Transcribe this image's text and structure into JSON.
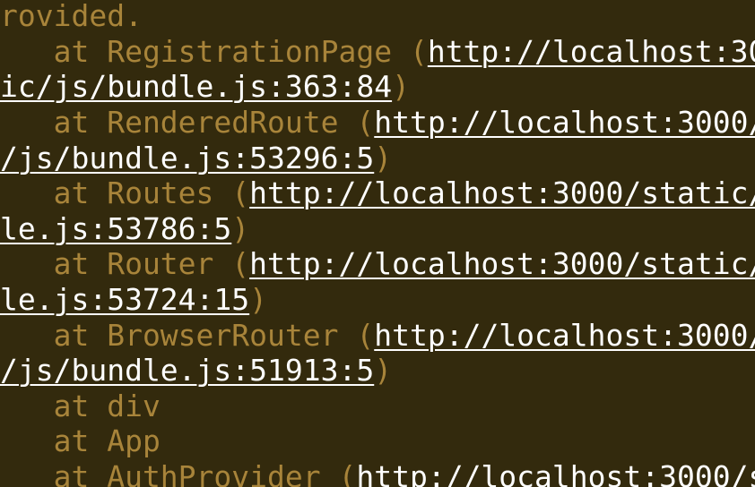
{
  "error_log": {
    "lines": [
      {
        "pre": "rovided.",
        "link": "",
        "post": ""
      },
      {
        "pre": "   at RegistrationPage (",
        "link": "http://localhost:30",
        "post": ""
      },
      {
        "pre": "",
        "link": "ic/js/bundle.js:363:84",
        "post": ")"
      },
      {
        "pre": "   at RenderedRoute (",
        "link": "http://localhost:3000/",
        "post": ""
      },
      {
        "pre": "",
        "link": "/js/bundle.js:53296:5",
        "post": ")"
      },
      {
        "pre": "   at Routes (",
        "link": "http://localhost:3000/static/",
        "post": ""
      },
      {
        "pre": "",
        "link": "le.js:53786:5",
        "post": ")"
      },
      {
        "pre": "   at Router (",
        "link": "http://localhost:3000/static/",
        "post": ""
      },
      {
        "pre": "",
        "link": "le.js:53724:15",
        "post": ")"
      },
      {
        "pre": "   at BrowserRouter (",
        "link": "http://localhost:3000/",
        "post": ""
      },
      {
        "pre": "",
        "link": "/js/bundle.js:51913:5",
        "post": ")"
      },
      {
        "pre": "   at div",
        "link": "",
        "post": ""
      },
      {
        "pre": "   at App",
        "link": "",
        "post": ""
      },
      {
        "pre": "   at AuthProvider (",
        "link": "http://localhost:3000/s",
        "post": ""
      }
    ]
  },
  "colors": {
    "background": "#332a0d",
    "text": "#a8843a",
    "link": "#ffffff"
  }
}
